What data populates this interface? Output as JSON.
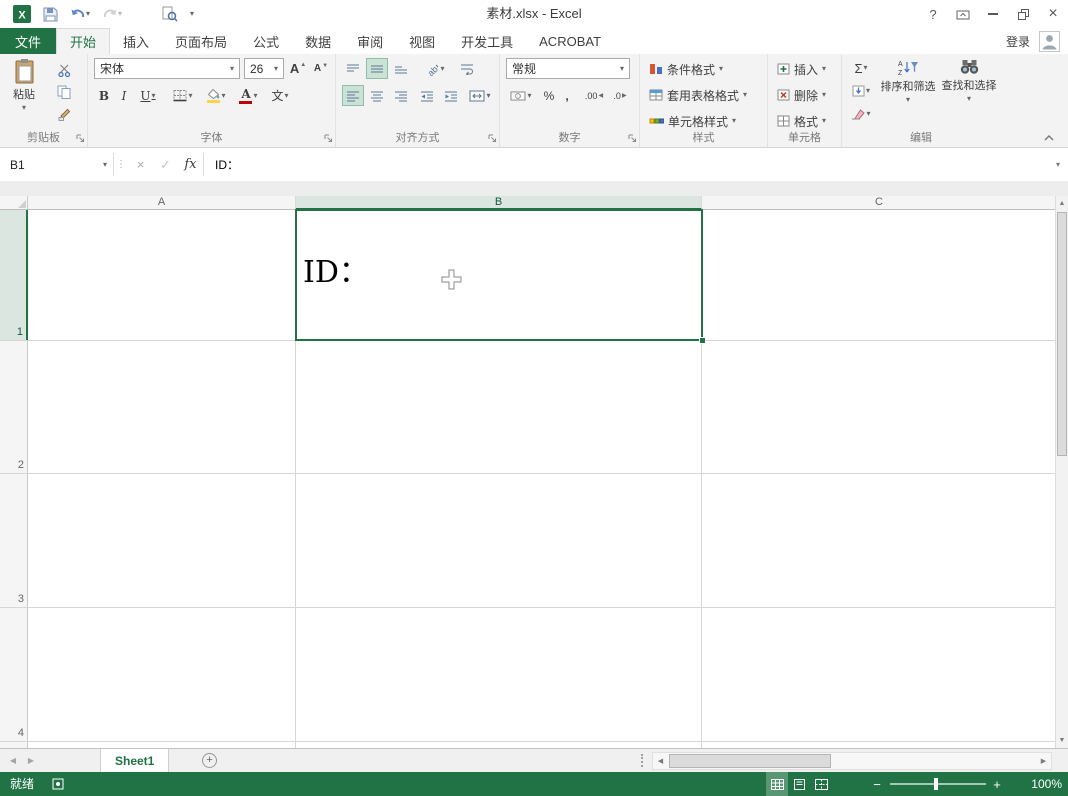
{
  "colors": {
    "accent": "#217346",
    "font_color_swatch": "#c00000",
    "fill_color_swatch": "#ffd24d",
    "status_bar_bg": "#217346"
  },
  "window": {
    "title": "素材.xlsx - Excel",
    "help_label": "?",
    "sign_in_label": "登录"
  },
  "icons": {
    "dropdown": "▾",
    "up_arrow": "▲",
    "down_arrow": "▼",
    "left_arrow": "◀",
    "right_arrow": "▶",
    "plus": "+",
    "minus": "−",
    "close": "×",
    "cancel": "×",
    "enter": "✓",
    "splitter_dots": "⋮"
  },
  "ribbon": {
    "tabs": [
      "文件",
      "开始",
      "插入",
      "页面布局",
      "公式",
      "数据",
      "审阅",
      "视图",
      "开发工具",
      "ACROBAT"
    ],
    "active_tab": "开始",
    "clipboard": {
      "label": "剪贴板",
      "paste_label": "粘贴"
    },
    "font": {
      "label": "字体",
      "font_name": "宋体",
      "font_size": "26",
      "bold": "B",
      "italic": "I",
      "underline": "U",
      "grow": "A",
      "shrink": "A",
      "font_color": "A",
      "phonetic": "文"
    },
    "alignment": {
      "label": "对齐方式"
    },
    "number": {
      "label": "数字",
      "format": "常规",
      "percent": "%",
      "comma": ",",
      "increase_decimal": ".00",
      "decrease_decimal": ".0"
    },
    "styles": {
      "label": "样式",
      "conditional": "条件格式",
      "format_table": "套用表格格式",
      "cell_styles": "单元格样式"
    },
    "cells": {
      "label": "单元格",
      "insert": "插入",
      "delete": "删除",
      "format": "格式"
    },
    "editing": {
      "label": "编辑",
      "autosum": "Σ",
      "sort_filter": "排序和筛选",
      "find_select": "查找和选择"
    }
  },
  "formula_bar": {
    "fx_label": "fx"
  },
  "active_cell": {
    "ref": "B1",
    "value": "ID："
  },
  "grid": {
    "columns": [
      "A",
      "B",
      "C"
    ],
    "rows": [
      "1",
      "2",
      "3",
      "4"
    ],
    "selected_column": "B",
    "selected_row": "1"
  },
  "sheet_bar": {
    "sheet_name": "Sheet1"
  },
  "status_bar": {
    "mode": "就绪",
    "zoom": "100%"
  }
}
